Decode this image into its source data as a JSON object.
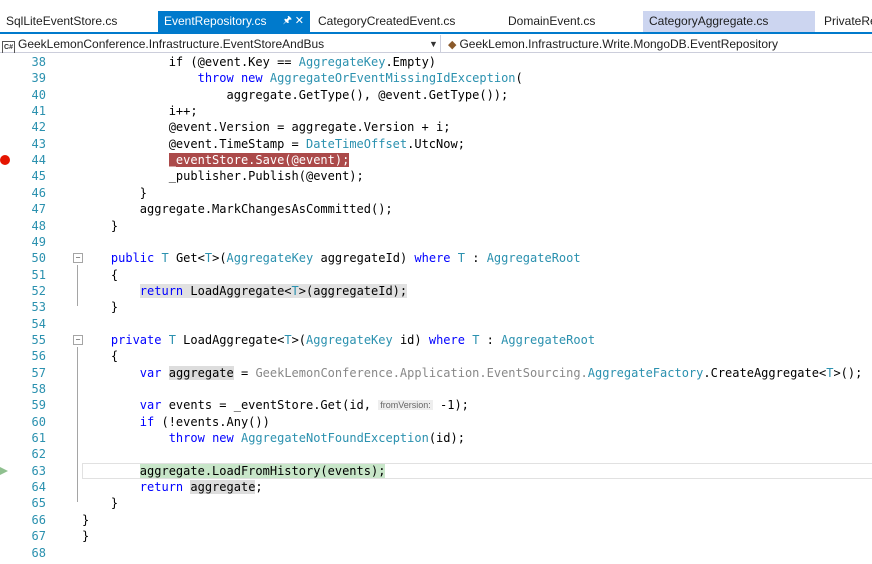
{
  "tabs": [
    {
      "label": "SqlLiteEventStore.cs",
      "state": "normal"
    },
    {
      "label": "EventRepository.cs",
      "state": "active"
    },
    {
      "label": "CategoryCreatedEvent.cs",
      "state": "normal"
    },
    {
      "label": "DomainEvent.cs",
      "state": "normal"
    },
    {
      "label": "CategoryAggregate.cs",
      "state": "selected"
    },
    {
      "label": "PrivateRe",
      "state": "normal"
    }
  ],
  "nav": {
    "project_badge": "C#",
    "project": "GeekLemonConference.Infrastructure.EventStoreAndBus",
    "type_path": "GeekLemon.Infrastructure.Write.MongoDB.EventRepository"
  },
  "lines": [
    {
      "n": "38",
      "tokens": [
        [
          "            if (@event.Key == ",
          ""
        ],
        [
          "AggregateKey",
          "ty"
        ],
        [
          ".Empty)",
          ""
        ]
      ]
    },
    {
      "n": "39",
      "tokens": [
        [
          "                ",
          ""
        ],
        [
          "throw",
          "kw"
        ],
        [
          " ",
          ""
        ],
        [
          "new",
          "kw"
        ],
        [
          " ",
          ""
        ],
        [
          "AggregateOrEventMissingIdException",
          "ty"
        ],
        [
          "(",
          ""
        ]
      ]
    },
    {
      "n": "40",
      "tokens": [
        [
          "                    aggregate.GetType(), @event.GetType());",
          ""
        ]
      ]
    },
    {
      "n": "41",
      "tokens": [
        [
          "            i++;",
          ""
        ]
      ]
    },
    {
      "n": "42",
      "tokens": [
        [
          "            @event.Version = aggregate.Version + i;",
          ""
        ]
      ]
    },
    {
      "n": "43",
      "tokens": [
        [
          "            @event.TimeStamp = ",
          ""
        ],
        [
          "DateTimeOffset",
          "ty"
        ],
        [
          ".UtcNow;",
          ""
        ]
      ]
    },
    {
      "n": "44",
      "tokens": [
        [
          "            ",
          ""
        ],
        [
          "_eventStore.Save(@event);",
          "bp"
        ]
      ]
    },
    {
      "n": "45",
      "tokens": [
        [
          "            _publisher.Publish(@event);",
          ""
        ]
      ]
    },
    {
      "n": "46",
      "tokens": [
        [
          "        }",
          ""
        ]
      ]
    },
    {
      "n": "47",
      "tokens": [
        [
          "        aggregate.MarkChangesAsCommitted();",
          ""
        ]
      ]
    },
    {
      "n": "48",
      "tokens": [
        [
          "    }",
          ""
        ]
      ]
    },
    {
      "n": "49",
      "tokens": []
    },
    {
      "n": "50",
      "tokens": [
        [
          "    ",
          ""
        ],
        [
          "public",
          "kw"
        ],
        [
          " ",
          ""
        ],
        [
          "T",
          "ty"
        ],
        [
          " Get<",
          ""
        ],
        [
          "T",
          "ty"
        ],
        [
          ">(",
          ""
        ],
        [
          "AggregateKey",
          "ty"
        ],
        [
          " aggregateId) ",
          ""
        ],
        [
          "where",
          "kw"
        ],
        [
          " ",
          ""
        ],
        [
          "T",
          "ty"
        ],
        [
          " : ",
          ""
        ],
        [
          "AggregateRoot",
          "ty"
        ]
      ]
    },
    {
      "n": "51",
      "tokens": [
        [
          "    {",
          ""
        ]
      ]
    },
    {
      "n": "52",
      "tokens": [
        [
          "        ",
          ""
        ],
        [
          "return",
          "kw gray"
        ],
        [
          " LoadAggregate<",
          "gray"
        ],
        [
          "T",
          "ty gray"
        ],
        [
          ">(aggregateId);",
          "gray"
        ]
      ]
    },
    {
      "n": "53",
      "tokens": [
        [
          "    }",
          ""
        ]
      ]
    },
    {
      "n": "54",
      "tokens": []
    },
    {
      "n": "55",
      "tokens": [
        [
          "    ",
          ""
        ],
        [
          "private",
          "kw"
        ],
        [
          " ",
          ""
        ],
        [
          "T",
          "ty"
        ],
        [
          " LoadAggregate<",
          ""
        ],
        [
          "T",
          "ty"
        ],
        [
          ">(",
          ""
        ],
        [
          "AggregateKey",
          "ty"
        ],
        [
          " id) ",
          ""
        ],
        [
          "where",
          "kw"
        ],
        [
          " ",
          ""
        ],
        [
          "T",
          "ty"
        ],
        [
          " : ",
          ""
        ],
        [
          "AggregateRoot",
          "ty"
        ]
      ]
    },
    {
      "n": "56",
      "tokens": [
        [
          "    {",
          ""
        ]
      ]
    },
    {
      "n": "57",
      "tokens": [
        [
          "        ",
          ""
        ],
        [
          "var",
          "kw"
        ],
        [
          " ",
          ""
        ],
        [
          "aggregate",
          "hl"
        ],
        [
          " = ",
          ""
        ],
        [
          "GeekLemonConference.Application.EventSourcing.",
          "dim"
        ],
        [
          "AggregateFactory",
          "ty"
        ],
        [
          ".CreateAggregate<",
          ""
        ],
        [
          "T",
          "ty"
        ],
        [
          ">();",
          ""
        ]
      ]
    },
    {
      "n": "58",
      "tokens": []
    },
    {
      "n": "59",
      "tokens": [
        [
          "        ",
          ""
        ],
        [
          "var",
          "kw"
        ],
        [
          " events = _eventStore.Get(id, ",
          ""
        ],
        [
          "fromVersion:",
          "hint"
        ],
        [
          " -1);",
          ""
        ]
      ]
    },
    {
      "n": "60",
      "tokens": [
        [
          "        ",
          ""
        ],
        [
          "if",
          "kw"
        ],
        [
          " (!events.Any())",
          ""
        ]
      ]
    },
    {
      "n": "61",
      "tokens": [
        [
          "            ",
          ""
        ],
        [
          "throw",
          "kw"
        ],
        [
          " ",
          ""
        ],
        [
          "new",
          "kw"
        ],
        [
          " ",
          ""
        ],
        [
          "AggregateNotFoundException",
          "ty"
        ],
        [
          "(id);",
          ""
        ]
      ]
    },
    {
      "n": "62",
      "tokens": []
    },
    {
      "n": "63",
      "tokens": [
        [
          "        ",
          ""
        ],
        [
          "aggregate.LoadFromHistory(events);",
          "cur"
        ]
      ]
    },
    {
      "n": "64",
      "tokens": [
        [
          "        ",
          ""
        ],
        [
          "return",
          "kw"
        ],
        [
          " ",
          ""
        ],
        [
          "aggregate",
          "hl"
        ],
        [
          ";",
          ""
        ]
      ]
    },
    {
      "n": "65",
      "tokens": [
        [
          "    }",
          ""
        ]
      ]
    },
    {
      "n": "66",
      "tokens": [
        [
          "}",
          ""
        ]
      ]
    },
    {
      "n": "67",
      "tokens": [
        [
          "}",
          ""
        ]
      ]
    },
    {
      "n": "68",
      "tokens": []
    }
  ],
  "breakpoint_line": "44",
  "current_line": "63",
  "fold_lines": [
    "50",
    "55"
  ],
  "colors": {
    "accent": "#007acc",
    "keyword": "#0000ff",
    "type": "#2b91af",
    "breakpoint": "#e51400"
  }
}
